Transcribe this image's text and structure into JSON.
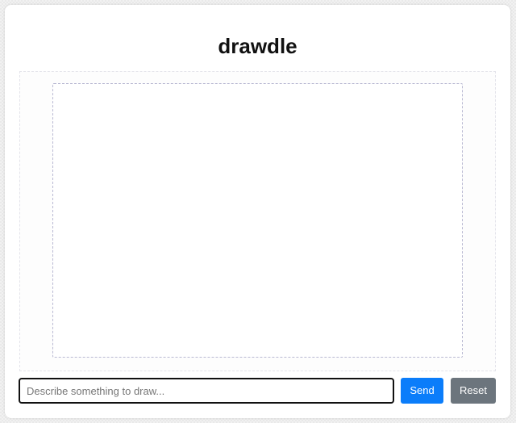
{
  "app": {
    "title": "drawdle"
  },
  "prompt": {
    "placeholder": "Describe something to draw...",
    "value": ""
  },
  "actions": {
    "send_label": "Send",
    "reset_label": "Reset"
  },
  "colors": {
    "send": "#0b7dfa",
    "reset": "#6c757d",
    "input_border": "#111111"
  }
}
